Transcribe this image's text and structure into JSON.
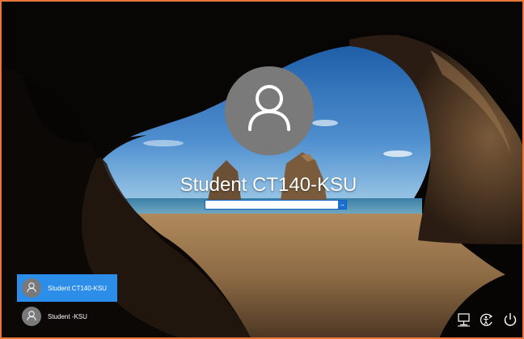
{
  "lock_screen": {
    "user_name": "Student CT140-KSU",
    "password_placeholder": "",
    "submit_arrow": "→"
  },
  "other_users": [
    {
      "label": "Student CT140-KSU",
      "selected": true
    },
    {
      "label": "Student -KSU",
      "selected": false
    }
  ],
  "tray": {
    "network_icon": "network-icon",
    "ease_of_access_icon": "ease-of-access-icon",
    "power_icon": "power-icon"
  },
  "colors": {
    "accent": "#2c8ee8",
    "frame_border": "#e8763a",
    "avatar_gray": "#7a7a7a"
  }
}
